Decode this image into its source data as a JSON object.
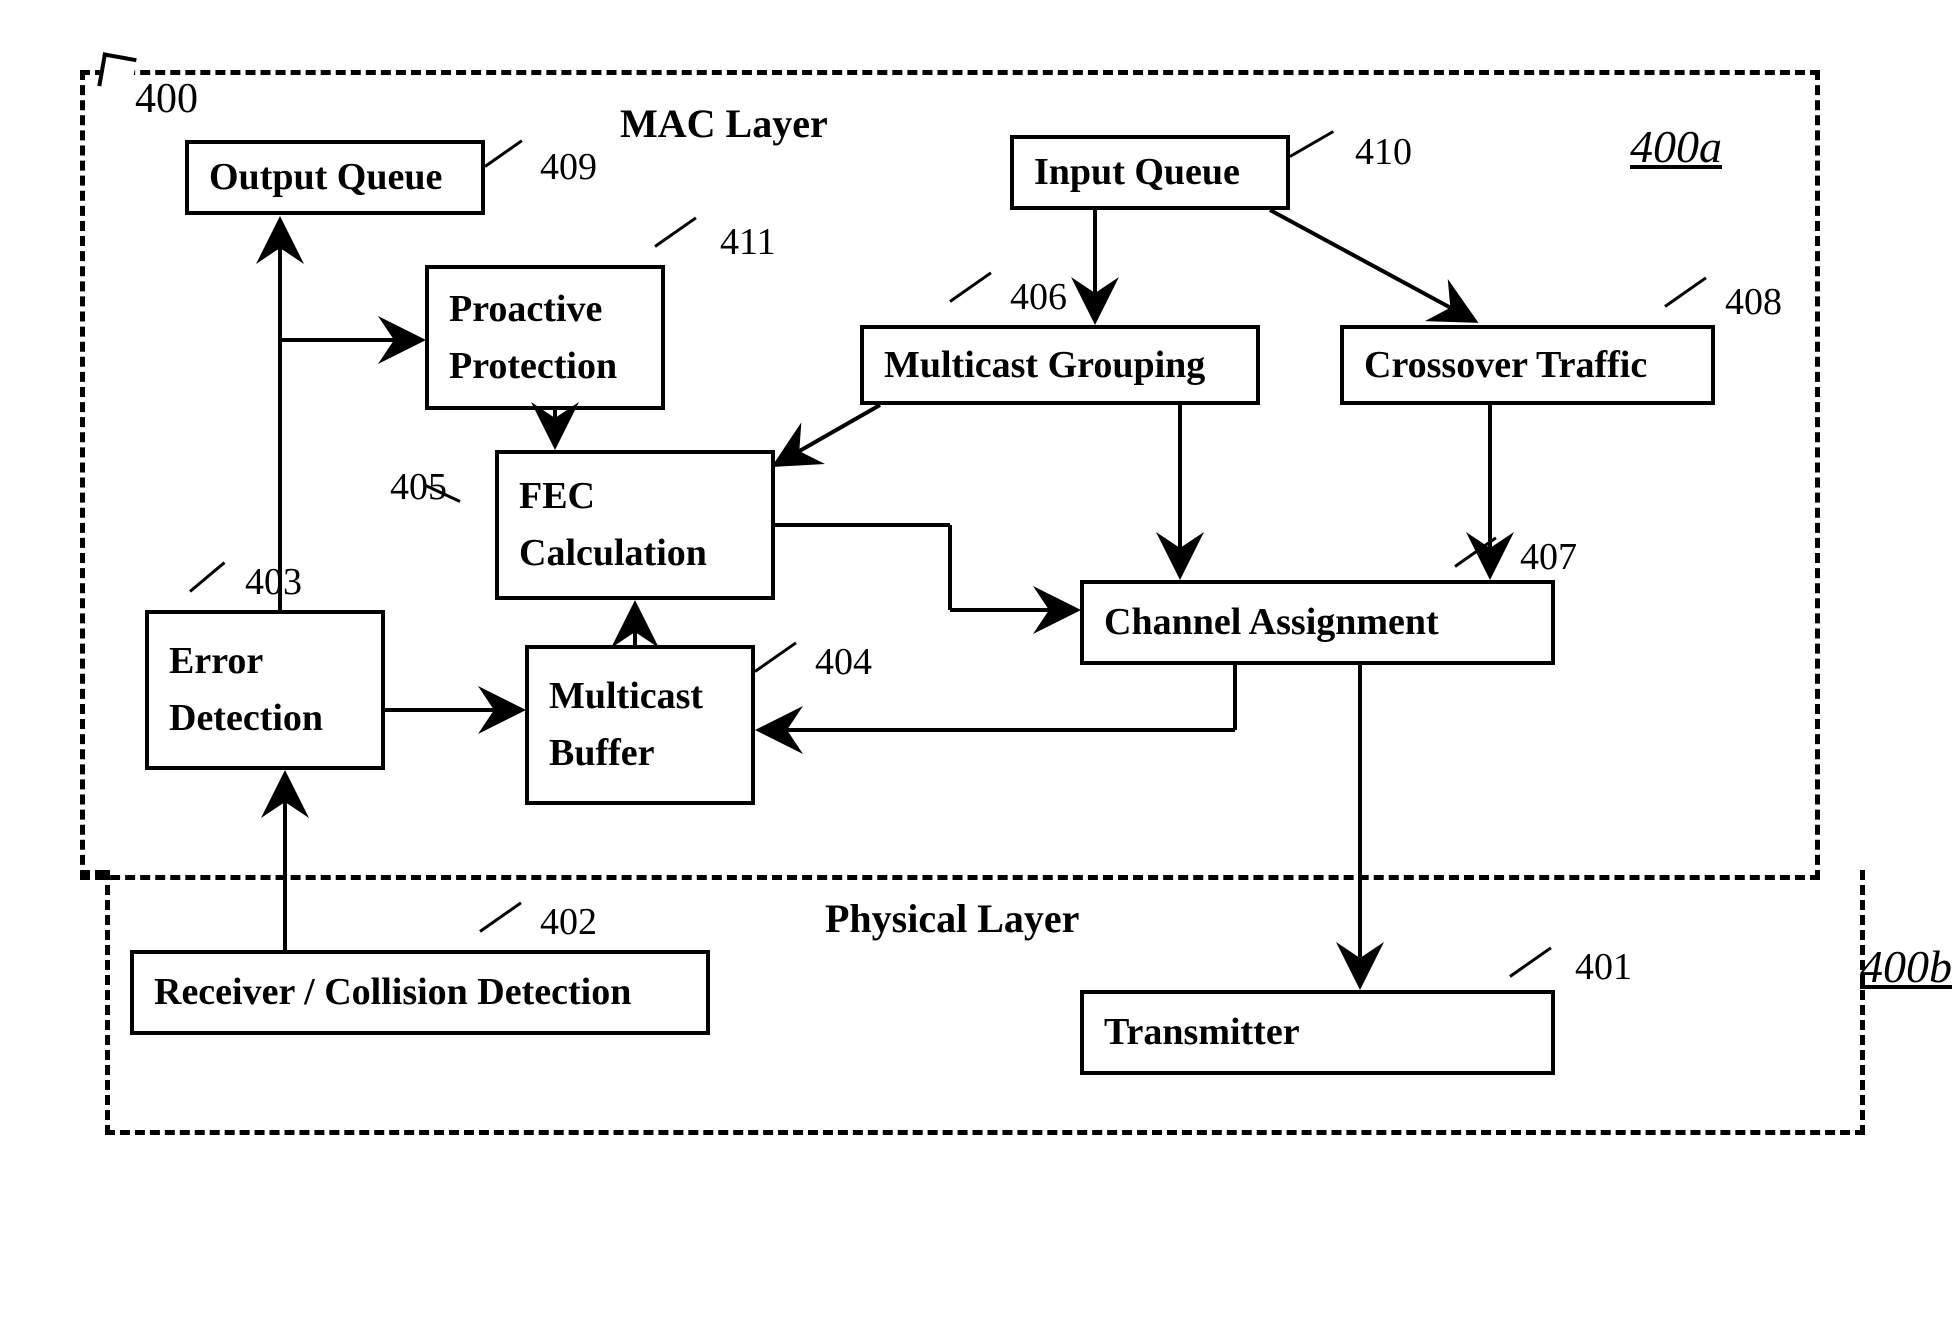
{
  "layers": {
    "outer_ref": "400",
    "mac_title": "MAC Layer",
    "mac_ref_hand": "400a",
    "phys_title": "Physical Layer",
    "phys_ref_hand": "400b"
  },
  "boxes": {
    "output_queue": {
      "label": "Output Queue",
      "ref": "409"
    },
    "input_queue": {
      "label": "Input Queue",
      "ref": "410"
    },
    "proactive_protection": {
      "label_l1": "Proactive",
      "label_l2": "Protection",
      "ref": "411"
    },
    "multicast_grouping": {
      "label": "Multicast Grouping",
      "ref": "406"
    },
    "crossover_traffic": {
      "label": "Crossover Traffic",
      "ref": "408"
    },
    "fec_calculation": {
      "label_l1": "FEC",
      "label_l2": "Calculation",
      "ref": "405"
    },
    "channel_assignment": {
      "label": "Channel Assignment",
      "ref": "407"
    },
    "error_detection": {
      "label_l1": "Error",
      "label_l2": "Detection",
      "ref": "403"
    },
    "multicast_buffer": {
      "label_l1": "Multicast",
      "label_l2": "Buffer",
      "ref": "404"
    },
    "receiver_collision": {
      "label": "Receiver / Collision Detection",
      "ref": "402"
    },
    "transmitter": {
      "label": "Transmitter",
      "ref": "401"
    }
  }
}
